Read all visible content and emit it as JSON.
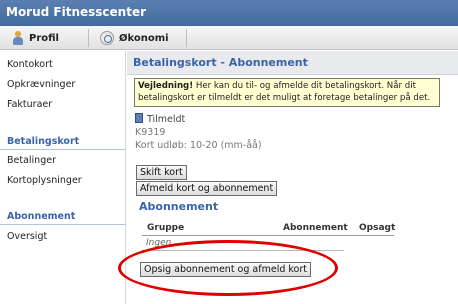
{
  "app": {
    "title": "Morud Fitnesscenter"
  },
  "tabs": [
    {
      "label": "Profil",
      "icon": "person-icon"
    },
    {
      "label": "Økonomi",
      "icon": "coin-icon"
    }
  ],
  "sidebar": {
    "links_top": [
      "Kontokort",
      "Opkrævninger",
      "Fakturaer"
    ],
    "section1": {
      "heading": "Betalingskort",
      "links": [
        "Betalinger",
        "Kortoplysninger"
      ]
    },
    "section2": {
      "heading": "Abonnement",
      "links": [
        "Oversigt"
      ]
    }
  },
  "main": {
    "title": "Betalingskort - Abonnement",
    "warning": {
      "bold": "Vejledning!",
      "text": " Her kan du til- og afmelde dit betalingskort. Når dit betalingskort er tilmeldt er det muligt at foretage betalinger på det."
    },
    "card": {
      "status": "Tilmeldt",
      "number": "K9319",
      "expiry": "Kort udløb: 10-20 (mm-åå)"
    },
    "buttons": {
      "change": "Skift kort",
      "unsubscribe_card": "Afmeld kort og abonnement",
      "cancel_all": "Opsig abonnement og afmeld kort"
    },
    "subscription": {
      "title": "Abonnement",
      "columns": [
        "Gruppe",
        "Abonnement",
        "Opsagt"
      ],
      "empty_text": "Ingen"
    }
  },
  "colors": {
    "header": "#4a72a6",
    "accent_text": "#3b63a8",
    "warning_bg": "#ffffd2",
    "highlight": "#e00000"
  }
}
